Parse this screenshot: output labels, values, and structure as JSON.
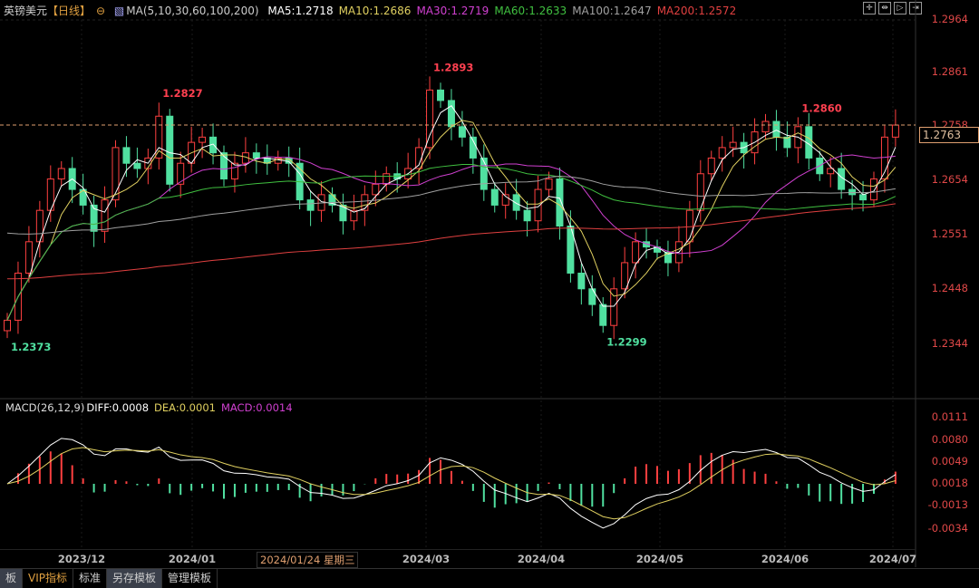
{
  "header": {
    "symbol": "英镑美元",
    "period": "【日线】",
    "ma_label": "MA(5,10,30,60,100,200)",
    "ma": [
      {
        "label": "MA5:1.2718",
        "color": "#ffffff"
      },
      {
        "label": "MA10:1.2686",
        "color": "#e0d060"
      },
      {
        "label": "MA30:1.2719",
        "color": "#d040d0"
      },
      {
        "label": "MA60:1.2633",
        "color": "#40c040"
      },
      {
        "label": "MA100:1.2647",
        "color": "#a0a0a0"
      },
      {
        "label": "MA200:1.2572",
        "color": "#e04040"
      }
    ]
  },
  "macd_header": {
    "label": "MACD(26,12,9)",
    "diff": "DIFF:0.0008",
    "dea": "DEA:0.0001",
    "macd": "MACD:0.0014"
  },
  "price_axis": [
    "1.2964",
    "1.2861",
    "1.2758",
    "1.2654",
    "1.2551",
    "1.2448",
    "1.2344"
  ],
  "current_price": "1.2763",
  "macd_axis": [
    "0.0111",
    "0.0080",
    "0.0049",
    "0.0018",
    "-0.0013",
    "-0.0034"
  ],
  "date_axis": [
    "2023/12",
    "2024/01",
    "2024/03",
    "2024/04",
    "2024/05",
    "2024/06",
    "2024/07"
  ],
  "cursor_date": "2024/01/24 星期三",
  "tabs": [
    "板",
    "VIP指标",
    "标准",
    "另存模板",
    "管理模板"
  ],
  "toolbar_icons": [
    "crosshair-icon",
    "zoom-range-icon",
    "play-icon",
    "move-right-icon"
  ],
  "colors": {
    "up": "#ff4040",
    "down": "#50e0a0",
    "axis": "#e04848"
  },
  "chart_data": {
    "type": "candlestick",
    "title": "英镑美元",
    "ylim": [
      1.229,
      1.299
    ],
    "close": [
      1.239,
      1.248,
      1.254,
      1.26,
      1.266,
      1.268,
      1.264,
      1.261,
      1.256,
      1.262,
      1.272,
      1.269,
      1.268,
      1.27,
      1.278,
      1.265,
      1.269,
      1.273,
      1.274,
      1.271,
      1.266,
      1.269,
      1.271,
      1.27,
      1.269,
      1.27,
      1.269,
      1.262,
      1.26,
      1.263,
      1.261,
      1.258,
      1.26,
      1.263,
      1.265,
      1.267,
      1.266,
      1.268,
      1.272,
      1.283,
      1.281,
      1.276,
      1.274,
      1.27,
      1.264,
      1.261,
      1.263,
      1.26,
      1.258,
      1.264,
      1.266,
      1.257,
      1.248,
      1.245,
      1.242,
      1.238,
      1.245,
      1.25,
      1.254,
      1.253,
      1.252,
      1.25,
      1.254,
      1.26,
      1.267,
      1.27,
      1.272,
      1.273,
      1.271,
      1.275,
      1.277,
      1.274,
      1.272,
      1.276,
      1.27,
      1.267,
      1.268,
      1.264,
      1.263,
      1.262,
      1.266,
      1.274,
      1.2763
    ],
    "annotations": [
      {
        "label": "1.2827",
        "index": 14,
        "type": "high"
      },
      {
        "label": "1.2893",
        "index": 39,
        "type": "high"
      },
      {
        "label": "1.2860",
        "index": 73,
        "type": "high"
      },
      {
        "label": "1.2373",
        "index": 0,
        "type": "low"
      },
      {
        "label": "1.2299",
        "index": 55,
        "type": "low"
      }
    ]
  }
}
